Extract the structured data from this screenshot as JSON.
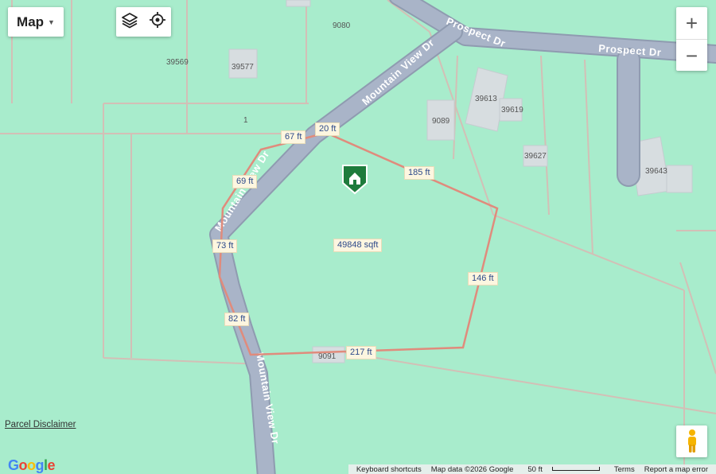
{
  "map": {
    "roads": {
      "prospect_dr": "Prospect Dr",
      "mountain_view_dr": "Mountain View Dr"
    },
    "parcels": [
      "9080",
      "39569",
      "39577",
      "1",
      "39613",
      "39619",
      "9089",
      "39627",
      "39643",
      "9091"
    ],
    "measurements": {
      "m20": "20 ft",
      "m67": "67 ft",
      "m185": "185 ft",
      "m69": "69 ft",
      "m73": "73 ft",
      "area": "49848 sqft",
      "m146": "146 ft",
      "m82": "82 ft",
      "m217": "217 ft"
    }
  },
  "controls": {
    "map_type": "Map",
    "zoom_in": "+",
    "zoom_out": "−"
  },
  "footer": {
    "parcel_disclaimer": "Parcel Disclaimer",
    "google": "Google",
    "keyboard_shortcuts": "Keyboard shortcuts",
    "map_data": "Map data ©2026 Google",
    "scale": "50 ft",
    "terms": "Terms",
    "report": "Report a map error"
  },
  "colors": {
    "land": "#a8eccc",
    "road": "#a9b4c8",
    "boundary": "#e08b7c",
    "pin": "#1e7b3c"
  }
}
